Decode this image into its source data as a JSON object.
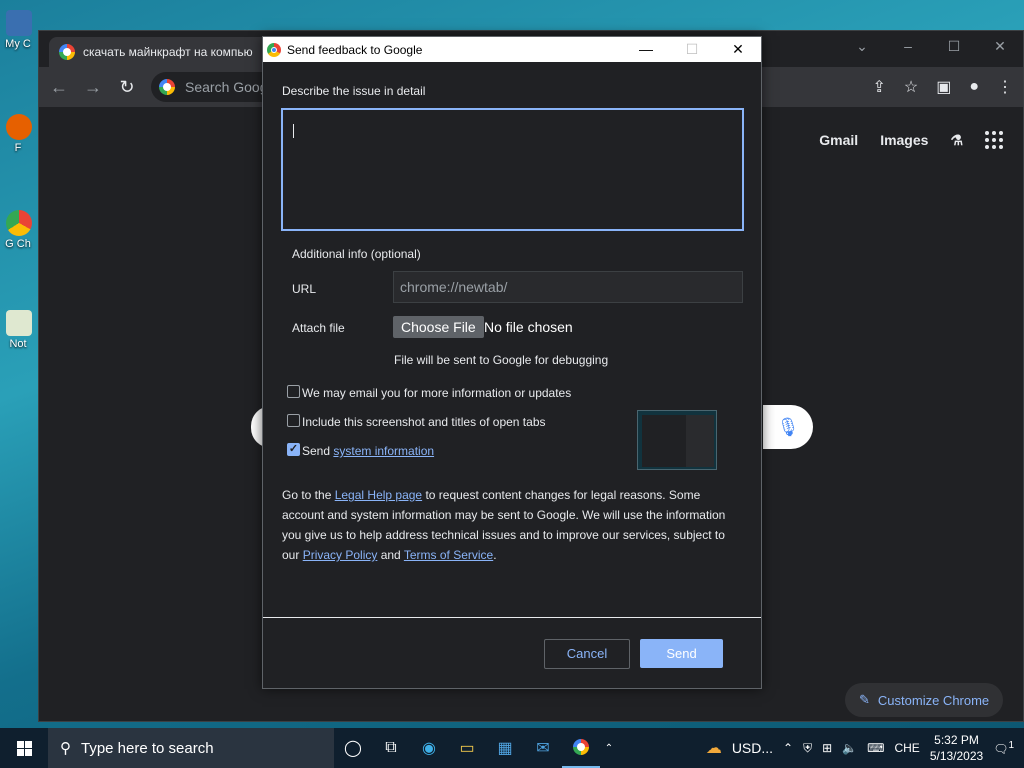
{
  "desktop": {
    "icons": [
      {
        "label": "My C"
      },
      {
        "label": "F"
      },
      {
        "label": "G Ch"
      },
      {
        "label": "Not"
      }
    ]
  },
  "browser": {
    "tab_title": "скачать майнкрафт на компью",
    "omnibox_placeholder": "Search Googl",
    "ntp_links": {
      "gmail": "Gmail",
      "images": "Images"
    },
    "customize_label": "Customize Chrome"
  },
  "dialog": {
    "title": "Send feedback to Google",
    "describe_label": "Describe the issue in detail",
    "description_value": "",
    "additional_info_label": "Additional info (optional)",
    "url_label": "URL",
    "url_value": "chrome://newtab/",
    "attach_label": "Attach file",
    "choose_file_label": "Choose File",
    "no_file_text": "No file chosen",
    "debug_note": "File will be sent to Google for debugging",
    "checkbox_email": {
      "label": "We may email you for more information or updates",
      "checked": false
    },
    "checkbox_screenshot": {
      "label": "Include this screenshot and titles of open tabs",
      "checked": false
    },
    "checkbox_system": {
      "label_prefix": "Send",
      "link": "system information",
      "checked": true
    },
    "legal": {
      "part1": "Go to the ",
      "legal_link": "Legal Help page",
      "part2": " to request content changes for legal reasons. Some account and system information may be sent to Google. We will use the information you give us to help address technical issues and to improve our services, subject to our ",
      "privacy_link": "Privacy Policy",
      "part3": " and ",
      "terms_link": "Terms of Service",
      "part4": "."
    },
    "cancel_label": "Cancel",
    "send_label": "Send"
  },
  "taskbar": {
    "search_placeholder": "Type here to search",
    "weather_text": "USD...",
    "language": "CHE",
    "time": "5:32 PM",
    "date": "5/13/2023",
    "notification_count": "1"
  }
}
